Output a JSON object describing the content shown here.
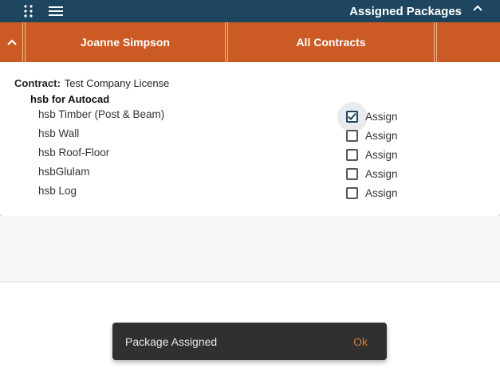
{
  "topbar": {
    "title": "Assigned Packages",
    "icons": [
      "apps-grid-icon",
      "hamburger-menu-icon",
      "chevron-up-icon"
    ],
    "background": "#1d4560"
  },
  "header_bar": {
    "background": "#cc5a24",
    "user_name": "Joanne Simpson",
    "filter_label": "All Contracts",
    "icons": [
      "chevron-up-icon"
    ]
  },
  "contract": {
    "label": "Contract:",
    "value": "Test Company License",
    "group_title": "hsb for Autocad",
    "packages": [
      {
        "name": "hsb Timber (Post & Beam)",
        "assign_label": "Assign",
        "checked": true
      },
      {
        "name": "hsb Wall",
        "assign_label": "Assign",
        "checked": false
      },
      {
        "name": "hsb Roof-Floor",
        "assign_label": "Assign",
        "checked": false
      },
      {
        "name": "hsbGlulam",
        "assign_label": "Assign",
        "checked": false
      },
      {
        "name": "hsb Log",
        "assign_label": "Assign",
        "checked": false
      }
    ]
  },
  "snackbar": {
    "message": "Package Assigned",
    "action_label": "Ok",
    "action_color": "#e07a3c"
  }
}
